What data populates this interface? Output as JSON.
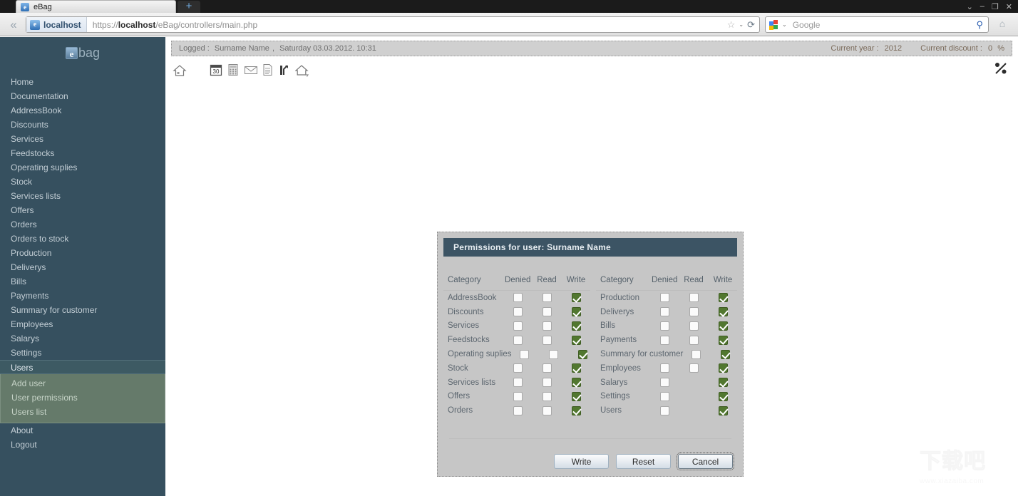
{
  "browser": {
    "tab": {
      "title": "eBag",
      "favicon": "e",
      "new_tab_label": "+"
    },
    "window_controls": [
      "⌄",
      "–",
      "❐",
      "✕"
    ],
    "back_label": "«",
    "url": {
      "identity_icon": "e",
      "identity_label": "localhost",
      "scheme": "https://",
      "host": "localhost",
      "path": "/eBag/controllers/main.php",
      "star_icon": "☆",
      "caret_icon": "⌄",
      "reload_icon": "⟳"
    },
    "search": {
      "engine": "Google",
      "placeholder": "Google",
      "caret_icon": "⌄",
      "go_icon": "⚲"
    },
    "home_icon": "⌂"
  },
  "sidebar": {
    "logo_mark": "e",
    "logo_text": "bag",
    "items": [
      {
        "label": "Home",
        "active": false
      },
      {
        "label": "Documentation",
        "active": false
      },
      {
        "label": "AddressBook",
        "active": false
      },
      {
        "label": "Discounts",
        "active": false
      },
      {
        "label": "Services",
        "active": false
      },
      {
        "label": "Feedstocks",
        "active": false
      },
      {
        "label": "Operating suplies",
        "active": false
      },
      {
        "label": "Stock",
        "active": false
      },
      {
        "label": "Services lists",
        "active": false
      },
      {
        "label": "Offers",
        "active": false
      },
      {
        "label": "Orders",
        "active": false
      },
      {
        "label": "Orders to stock",
        "active": false
      },
      {
        "label": "Production",
        "active": false
      },
      {
        "label": "Deliverys",
        "active": false
      },
      {
        "label": "Bills",
        "active": false
      },
      {
        "label": "Payments",
        "active": false
      },
      {
        "label": "Summary for customer",
        "active": false
      },
      {
        "label": "Employees",
        "active": false
      },
      {
        "label": "Salarys",
        "active": false
      },
      {
        "label": "Settings",
        "active": false
      },
      {
        "label": "Users",
        "active": true
      }
    ],
    "submenu": [
      {
        "label": "Add user"
      },
      {
        "label": "User permissions"
      },
      {
        "label": "Users list"
      }
    ],
    "items_after": [
      {
        "label": "About"
      },
      {
        "label": "Logout"
      }
    ]
  },
  "status": {
    "logged_label": "Logged :",
    "user": "Surname Name",
    "separator": ",",
    "datetime": "Saturday 03.03.2012. 10:31",
    "current_year_label": "Current year :",
    "current_year_value": "2012",
    "current_discount_label": "Current discount :",
    "current_discount_value": "0",
    "current_discount_unit": "%"
  },
  "toolbar": {
    "icons": [
      "home-icon",
      "calendar-icon",
      "calculator-icon",
      "envelope-icon",
      "document-icon",
      "chart-icon",
      "home-export-icon"
    ],
    "calendar_day": "30",
    "discount_icon": "percent-icon"
  },
  "dialog": {
    "title": "Permissions for user: Surname Name",
    "headers": {
      "category": "Category",
      "denied": "Denied",
      "read": "Read",
      "write": "Write"
    },
    "columns": [
      {
        "rows": [
          {
            "category": "AddressBook",
            "denied": false,
            "read": false,
            "write": true,
            "has_denied": true,
            "has_read": true,
            "has_write": true
          },
          {
            "category": "Discounts",
            "denied": false,
            "read": false,
            "write": true,
            "has_denied": true,
            "has_read": true,
            "has_write": true
          },
          {
            "category": "Services",
            "denied": false,
            "read": false,
            "write": true,
            "has_denied": true,
            "has_read": true,
            "has_write": true
          },
          {
            "category": "Feedstocks",
            "denied": false,
            "read": false,
            "write": true,
            "has_denied": true,
            "has_read": true,
            "has_write": true
          },
          {
            "category": "Operating suplies",
            "denied": false,
            "read": false,
            "write": true,
            "has_denied": true,
            "has_read": true,
            "has_write": true
          },
          {
            "category": "Stock",
            "denied": false,
            "read": false,
            "write": true,
            "has_denied": true,
            "has_read": true,
            "has_write": true
          },
          {
            "category": "Services lists",
            "denied": false,
            "read": false,
            "write": true,
            "has_denied": true,
            "has_read": true,
            "has_write": true
          },
          {
            "category": "Offers",
            "denied": false,
            "read": false,
            "write": true,
            "has_denied": true,
            "has_read": true,
            "has_write": true
          },
          {
            "category": "Orders",
            "denied": false,
            "read": false,
            "write": true,
            "has_denied": true,
            "has_read": true,
            "has_write": true
          }
        ]
      },
      {
        "rows": [
          {
            "category": "Production",
            "denied": false,
            "read": false,
            "write": true,
            "has_denied": true,
            "has_read": true,
            "has_write": true
          },
          {
            "category": "Deliverys",
            "denied": false,
            "read": false,
            "write": true,
            "has_denied": true,
            "has_read": true,
            "has_write": true
          },
          {
            "category": "Bills",
            "denied": false,
            "read": false,
            "write": true,
            "has_denied": true,
            "has_read": true,
            "has_write": true
          },
          {
            "category": "Payments",
            "denied": false,
            "read": false,
            "write": true,
            "has_denied": true,
            "has_read": true,
            "has_write": true
          },
          {
            "category": "Summary for customer",
            "denied": false,
            "read": true,
            "write": false,
            "has_denied": true,
            "has_read": true,
            "has_write": false
          },
          {
            "category": "Employees",
            "denied": false,
            "read": false,
            "write": true,
            "has_denied": true,
            "has_read": true,
            "has_write": true
          },
          {
            "category": "Salarys",
            "denied": false,
            "read": false,
            "write": true,
            "has_denied": true,
            "has_read": false,
            "has_write": true
          },
          {
            "category": "Settings",
            "denied": false,
            "read": false,
            "write": true,
            "has_denied": true,
            "has_read": false,
            "has_write": true
          },
          {
            "category": "Users",
            "denied": false,
            "read": false,
            "write": true,
            "has_denied": true,
            "has_read": false,
            "has_write": true
          }
        ]
      }
    ],
    "buttons": [
      {
        "label": "Write",
        "focused": false
      },
      {
        "label": "Reset",
        "focused": false
      },
      {
        "label": "Cancel",
        "focused": true
      }
    ]
  },
  "watermark": {
    "text": "下载吧",
    "url": "www.xiazaiba.com"
  },
  "colors": {
    "sidebar_bg": "#36505f",
    "dialog_title_bg": "#3c5464",
    "dialog_bg": "#c6c6c6",
    "checkbox_checked": "#51772f",
    "submenu_bg": "#657a6a",
    "status_bg": "#d0d0d0",
    "accent_text": "#7a6a5a"
  }
}
